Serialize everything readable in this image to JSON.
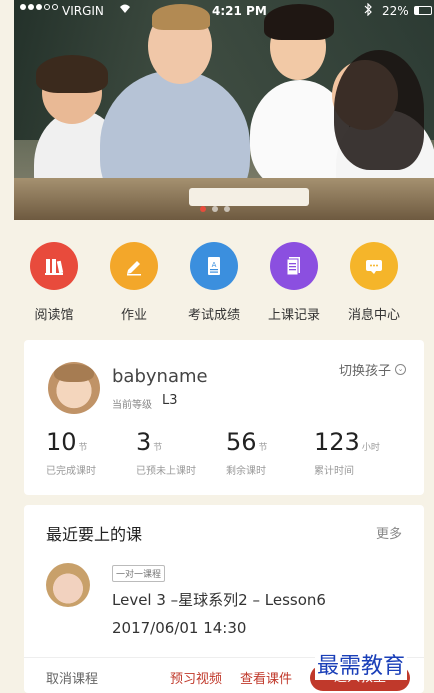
{
  "status_bar": {
    "carrier": "VIRGIN",
    "time": "4:21 PM",
    "battery": "22%"
  },
  "banner": {
    "slides": 3,
    "active_slide": 1
  },
  "nav": [
    {
      "label": "阅读馆",
      "icon": "books-icon",
      "color": "#e84b3c"
    },
    {
      "label": "作业",
      "icon": "pencil-icon",
      "color": "#f3a72a"
    },
    {
      "label": "考试成绩",
      "icon": "document-icon",
      "color": "#3b8fde"
    },
    {
      "label": "上课记录",
      "icon": "record-icon",
      "color": "#8b4fe0"
    },
    {
      "label": "消息中心",
      "icon": "message-icon",
      "color": "#f5b52a"
    }
  ],
  "profile": {
    "name": "babyname",
    "level_label": "当前等级",
    "level": "L3",
    "switch_label": "切换孩子",
    "stats": [
      {
        "value": "10",
        "unit": "节",
        "caption": "已完成课时"
      },
      {
        "value": "3",
        "unit": "节",
        "caption": "已预未上课时"
      },
      {
        "value": "56",
        "unit": "节",
        "caption": "剩余课时"
      },
      {
        "value": "123",
        "unit": "小时",
        "caption": "累计时间"
      }
    ]
  },
  "upcoming": {
    "title": "最近要上的课",
    "more": "更多",
    "tag": "一对一课程",
    "lesson": "Level 3 –星球系列2 – Lesson6",
    "time": "2017/06/01 14:30",
    "actions": {
      "cancel": "取消课程",
      "preview": "预习视频",
      "view": "查看课件",
      "enter": "进入教室"
    }
  },
  "watermark": "最需教育",
  "colors": {
    "accent": "#c0392b",
    "background": "#f6f2e6"
  }
}
